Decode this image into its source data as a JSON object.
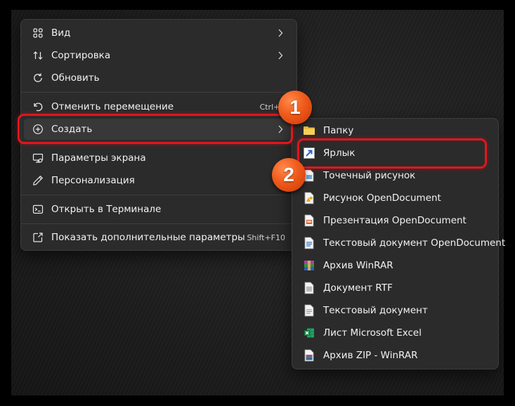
{
  "context_menu": {
    "items": [
      {
        "label": "Вид",
        "icon": "view-grid-icon",
        "has_submenu": true
      },
      {
        "label": "Сортировка",
        "icon": "sort-icon",
        "has_submenu": true
      },
      {
        "label": "Обновить",
        "icon": "refresh-icon"
      },
      {
        "label": "Отменить перемещение",
        "icon": "undo-icon",
        "shortcut": "Ctrl+Я"
      },
      {
        "label": "Создать",
        "icon": "add-circle-icon",
        "has_submenu": true,
        "highlighted": true
      },
      {
        "label": "Параметры экрана",
        "icon": "display-settings-icon"
      },
      {
        "label": "Персонализация",
        "icon": "pen-icon"
      },
      {
        "label": "Открыть в Терминале",
        "icon": "terminal-icon"
      },
      {
        "label": "Показать дополнительные параметры",
        "icon": "share-options-icon",
        "shortcut": "Shift+F10"
      }
    ]
  },
  "submenu": {
    "items": [
      {
        "label": "Папку",
        "icon": "folder-icon"
      },
      {
        "label": "Ярлык",
        "icon": "shortcut-icon"
      },
      {
        "label": "Точечный рисунок",
        "icon": "bitmap-icon"
      },
      {
        "label": "Рисунок OpenDocument",
        "icon": "odg-icon"
      },
      {
        "label": "Презентация OpenDocument",
        "icon": "odp-icon"
      },
      {
        "label": "Текстовый документ OpenDocument",
        "icon": "odt-icon"
      },
      {
        "label": "Архив WinRAR",
        "icon": "winrar-icon"
      },
      {
        "label": "Документ RTF",
        "icon": "rtf-icon"
      },
      {
        "label": "Текстовый документ",
        "icon": "text-document-icon"
      },
      {
        "label": "Лист Microsoft Excel",
        "icon": "excel-icon"
      },
      {
        "label": "Архив ZIP - WinRAR",
        "icon": "winrar-zip-icon"
      }
    ]
  },
  "annotations": {
    "step1": "1",
    "step2": "2",
    "highlight_color": "#e0161e",
    "badge_color": "#f05a1a"
  }
}
